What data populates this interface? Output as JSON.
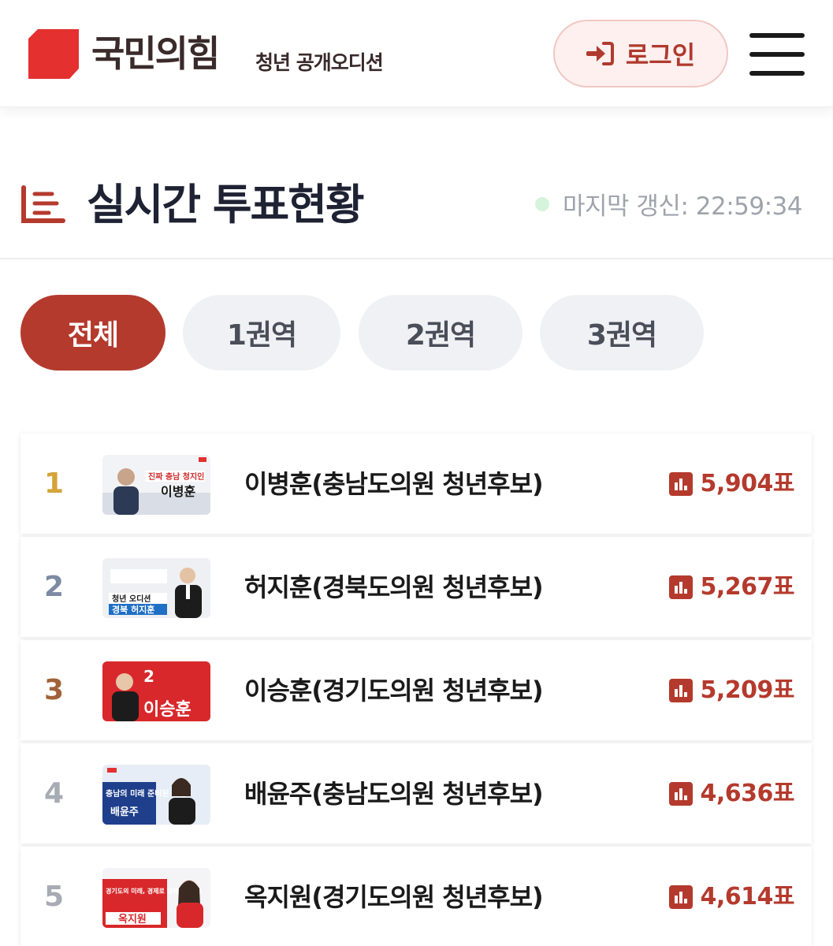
{
  "header": {
    "logo_text": "국민의힘",
    "logo_sub": "청년 공개오디션",
    "login_label": "로그인"
  },
  "page": {
    "title": "실시간 투표현황",
    "last_update": "마지막 갱신: 22:59:34"
  },
  "tabs": [
    {
      "label": "전체",
      "active": true
    },
    {
      "label": "1권역",
      "active": false
    },
    {
      "label": "2권역",
      "active": false
    },
    {
      "label": "3권역",
      "active": false
    }
  ],
  "ranking": [
    {
      "rank": "1",
      "name": "이병훈(충남도의원 청년후보)",
      "votes": "5,904표",
      "rank_color": "#d4a43a",
      "thumb": {
        "banner": "진짜 충남 청지인",
        "person": "이병훈"
      }
    },
    {
      "rank": "2",
      "name": "허지훈(경북도의원 청년후보)",
      "votes": "5,267표",
      "rank_color": "#7d8aa3",
      "thumb": {
        "banner": "청년 오디션",
        "person": "경북 허지훈"
      }
    },
    {
      "rank": "3",
      "name": "이승훈(경기도의원 청년후보)",
      "votes": "5,209표",
      "rank_color": "#a0623a",
      "thumb": {
        "banner": "2",
        "person": "이승훈"
      }
    },
    {
      "rank": "4",
      "name": "배윤주(충남도의원 청년후보)",
      "votes": "4,636표",
      "rank_color": "#a7abb3",
      "thumb": {
        "banner": "충남의 미래 준비된 일꾼",
        "person": "배윤주"
      }
    },
    {
      "rank": "5",
      "name": "옥지원(경기도의원 청년후보)",
      "votes": "4,614표",
      "rank_color": "#a7abb3",
      "thumb": {
        "banner": "경기도의 미래, 경제로 답하겠습니다",
        "person": "옥지원"
      }
    }
  ],
  "colors": {
    "accent": "#b43a2d",
    "logo_red": "#e4302f"
  }
}
